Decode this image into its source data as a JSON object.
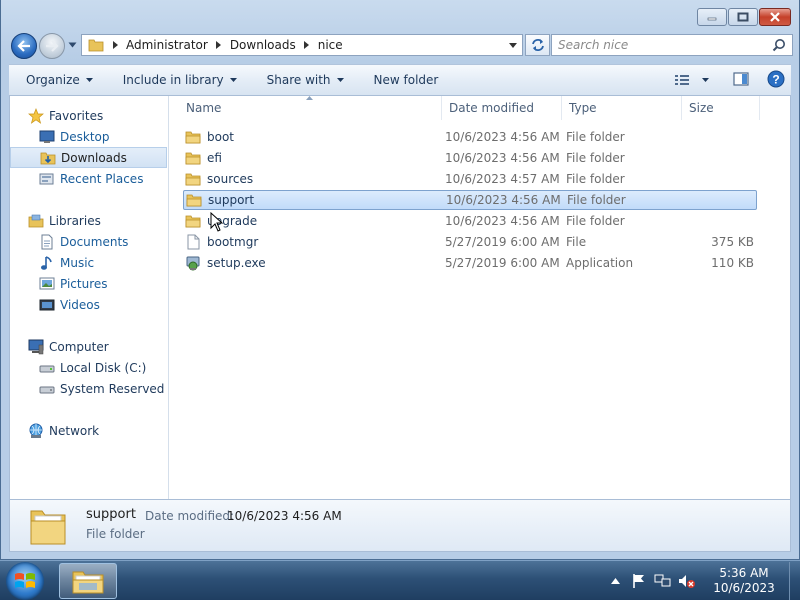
{
  "window": {
    "caption_buttons": [
      "minimize",
      "maximize",
      "close"
    ]
  },
  "address": {
    "crumbs": [
      "Administrator",
      "Downloads",
      "nice"
    ],
    "search_placeholder": "Search nice"
  },
  "toolbar": {
    "organize": "Organize",
    "include_in_library": "Include in library",
    "share_with": "Share with",
    "new_folder": "New folder"
  },
  "nav": {
    "favorites": "Favorites",
    "desktop": "Desktop",
    "downloads": "Downloads",
    "recent_places": "Recent Places",
    "libraries": "Libraries",
    "documents": "Documents",
    "music": "Music",
    "pictures": "Pictures",
    "videos": "Videos",
    "computer": "Computer",
    "local_disk": "Local Disk (C:)",
    "system_reserved": "System Reserved (E:)",
    "network": "Network",
    "selected": "Downloads"
  },
  "columns": {
    "name": "Name",
    "date_modified": "Date modified",
    "type": "Type",
    "size": "Size"
  },
  "files": [
    {
      "name": "boot",
      "date": "10/6/2023 4:56 AM",
      "type": "File folder",
      "size": "",
      "icon": "folder-icon"
    },
    {
      "name": "efi",
      "date": "10/6/2023 4:56 AM",
      "type": "File folder",
      "size": "",
      "icon": "folder-icon"
    },
    {
      "name": "sources",
      "date": "10/6/2023 4:57 AM",
      "type": "File folder",
      "size": "",
      "icon": "folder-icon"
    },
    {
      "name": "support",
      "date": "10/6/2023 4:56 AM",
      "type": "File folder",
      "size": "",
      "icon": "folder-icon",
      "selected": true
    },
    {
      "name": "upgrade",
      "date": "10/6/2023 4:56 AM",
      "type": "File folder",
      "size": "",
      "icon": "folder-icon"
    },
    {
      "name": "bootmgr",
      "date": "5/27/2019 6:00 AM",
      "type": "File",
      "size": "375 KB",
      "icon": "file-icon"
    },
    {
      "name": "setup.exe",
      "date": "5/27/2019 6:00 AM",
      "type": "Application",
      "size": "110 KB",
      "icon": "setup-icon"
    }
  ],
  "details": {
    "name": "support",
    "date_label": "Date modified:",
    "date_value": "10/6/2023 4:56 AM",
    "type": "File folder"
  },
  "taskbar": {
    "time": "5:36 AM",
    "date": "10/6/2023"
  },
  "colors": {
    "folder": "#e8c35a",
    "selection": "#c1dbfa",
    "link": "#1a5d9a"
  }
}
